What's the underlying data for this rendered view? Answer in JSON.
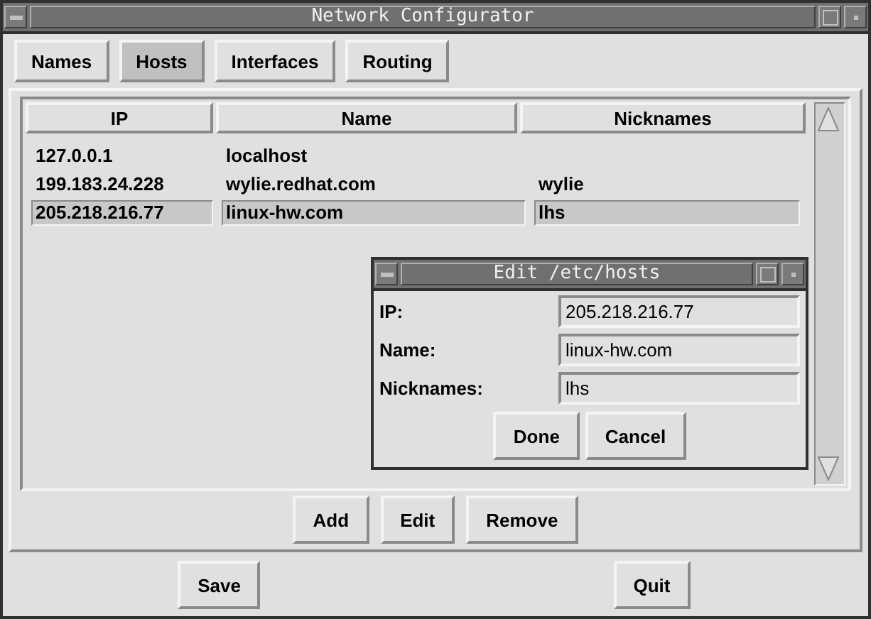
{
  "window": {
    "title": "Network Configurator"
  },
  "tabs": [
    {
      "label": "Names",
      "selected": false
    },
    {
      "label": "Hosts",
      "selected": true
    },
    {
      "label": "Interfaces",
      "selected": false
    },
    {
      "label": "Routing",
      "selected": false
    }
  ],
  "hosts": {
    "columns": [
      "IP",
      "Name",
      "Nicknames"
    ],
    "rows": [
      {
        "cells": [
          "127.0.0.1",
          "localhost",
          ""
        ],
        "selected": false
      },
      {
        "cells": [
          "199.183.24.228",
          "wylie.redhat.com",
          "wylie"
        ],
        "selected": false
      },
      {
        "cells": [
          "205.218.216.77",
          "linux-hw.com",
          "lhs"
        ],
        "selected": true
      }
    ]
  },
  "list_buttons": [
    "Add",
    "Edit",
    "Remove"
  ],
  "dialog": {
    "title": "Edit /etc/hosts",
    "fields": [
      {
        "label": "IP:",
        "value": "205.218.216.77"
      },
      {
        "label": "Name:",
        "value": "linux-hw.com"
      },
      {
        "label": "Nicknames:",
        "value": "lhs"
      }
    ],
    "buttons": [
      "Done",
      "Cancel"
    ]
  },
  "footer_buttons": [
    "Save",
    "Quit"
  ]
}
